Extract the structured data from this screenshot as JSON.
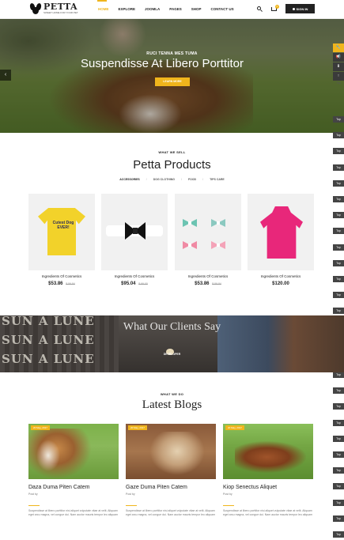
{
  "header": {
    "logo_name": "PETTA",
    "logo_tagline": "SWEET HOME FOR YOUR PET",
    "nav": [
      "HOME",
      "EXPLORE",
      "JOOMLA",
      "PAGES",
      "SHOP",
      "CONTACT US"
    ],
    "cart_count": "0",
    "signin_label": "SIGN IN"
  },
  "hero": {
    "subtitle": "RUCI TENNA MES TUMA",
    "title": "Suspendisse At Libero Porttitor",
    "button": "LEARN MORE",
    "prev_arrow": "‹"
  },
  "side": {
    "buttons": [
      "🔧",
      "📢",
      "⬇",
      "↑"
    ],
    "top_label": "Top",
    "top_tabs": [
      "Top",
      "Top",
      "Top",
      "Top",
      "Top",
      "Top",
      "Top",
      "Top",
      "Top",
      "Top",
      "Top",
      "Top",
      "Top",
      "Top",
      "Top",
      "Top",
      "Top",
      "Top",
      "Top",
      "Top",
      "Top",
      "Top",
      "Top",
      "Top",
      "Top",
      "Top",
      "Top"
    ]
  },
  "products_section": {
    "kicker": "WHAT WE SELL",
    "title": "Petta Products",
    "filters": [
      "ACCESSORIES",
      "DOG CLOTHING",
      "FOOD",
      "TIPS CARE"
    ],
    "items": [
      {
        "name": "Ingredients Of Cosmetics",
        "price": "$53.86",
        "old_price": "$ 59.84",
        "art_text": "Cutest Dog EVER!"
      },
      {
        "name": "Ingredients Of Cosmetics",
        "price": "$95.04",
        "old_price": "$ 99.00"
      },
      {
        "name": "Ingredients Of Cosmetics",
        "price": "$53.86",
        "old_price": "$ 59.84"
      },
      {
        "name": "Ingredients Of Cosmetics",
        "price": "$120.00",
        "old_price": ""
      }
    ]
  },
  "testimonials": {
    "title": "What Our Clients Say",
    "name": "DEVELOPER",
    "bg_words": [
      "SUN A LUNE",
      "SUN A LUNE",
      "SUN A LUNE"
    ]
  },
  "blogs_section": {
    "kicker": "WHAT WE DO",
    "title": "Latest Blogs",
    "posts": [
      {
        "date": "20 May, 2017",
        "title": "Daza Duma Piten Catem",
        "meta": "Post by",
        "desc": "Suspendisse at libero porttitor nisi aliquet vulputate vitae at velit. Aliquam eget arcu magna, vel congue dui. Nam auctor mauris tempor leo aliquam"
      },
      {
        "date": "20 May, 2017",
        "title": "Gaze Duma Piten Catem",
        "meta": "Post by",
        "desc": "Suspendisse at libero porttitor nisi aliquet vulputate vitae at velit. Aliquam eget arcu magna, vel congue dui. Nam auctor mauris tempor leo aliquam"
      },
      {
        "date": "20 May, 2017",
        "title": "Kiop Senectus Aliquet",
        "meta": "Post by",
        "desc": "Suspendisse at libero porttitor nisi aliquet vulputate vitae at velit. Aliquam eget arcu magna, vel congue dui. Nam auctor mauris tempor leo aliquam"
      }
    ]
  },
  "colors": {
    "accent": "#f0b51c",
    "dark": "#222222"
  }
}
